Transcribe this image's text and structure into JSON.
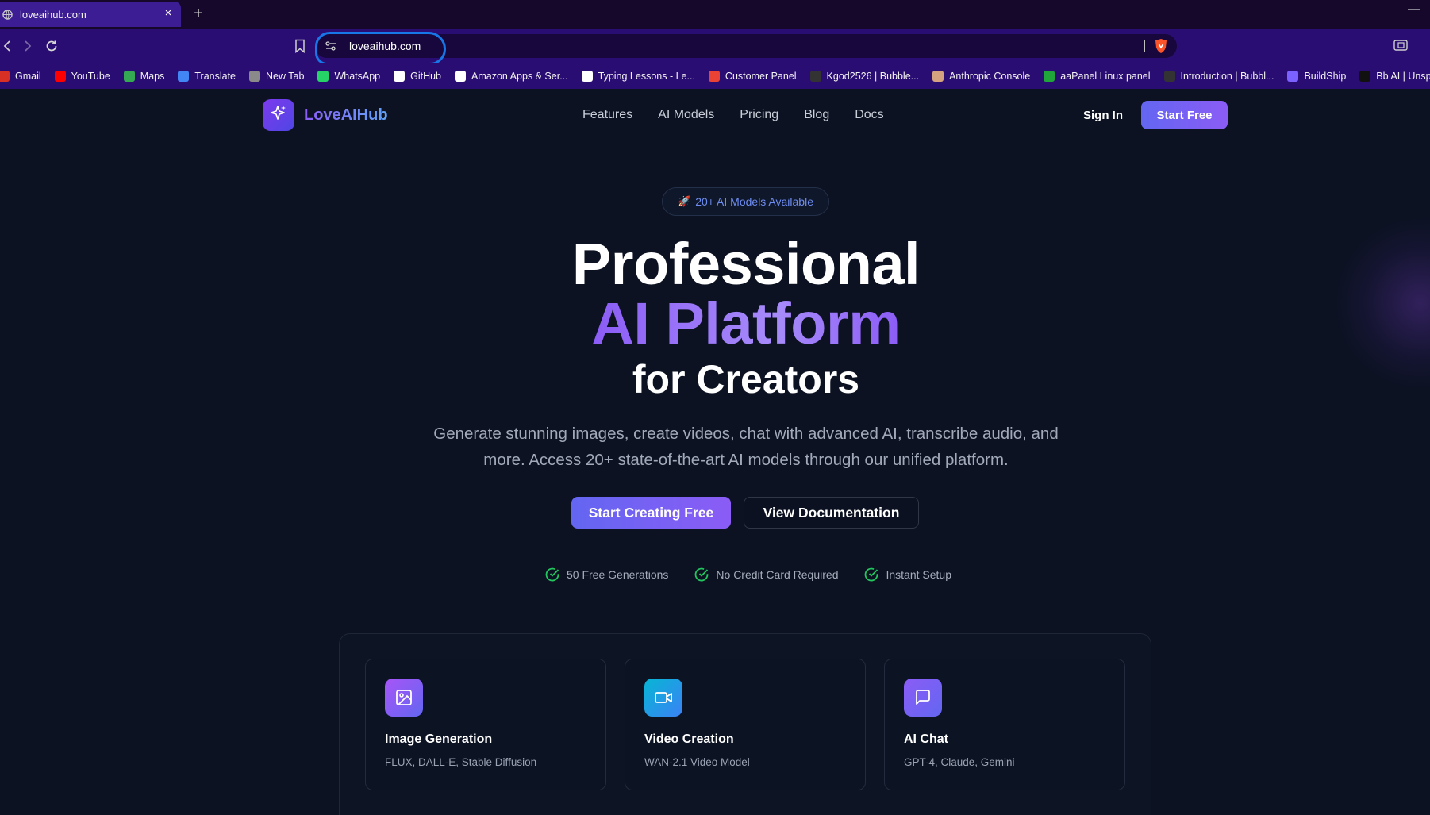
{
  "browser": {
    "tab_title": "loveaihub.com",
    "tab_close": "×",
    "new_tab": "+",
    "url": "loveaihub.com",
    "bookmarks": [
      {
        "label": "Gmail",
        "icon": "gmail-icon",
        "color": "#d93025"
      },
      {
        "label": "YouTube",
        "icon": "youtube-icon",
        "color": "#ff0000"
      },
      {
        "label": "Maps",
        "icon": "maps-icon",
        "color": "#34a853"
      },
      {
        "label": "Translate",
        "icon": "translate-icon",
        "color": "#4285f4"
      },
      {
        "label": "New Tab",
        "icon": "globe-icon",
        "color": "#8a8a8a"
      },
      {
        "label": "WhatsApp",
        "icon": "whatsapp-icon",
        "color": "#25d366"
      },
      {
        "label": "GitHub",
        "icon": "github-icon",
        "color": "#ffffff"
      },
      {
        "label": "Amazon Apps & Ser...",
        "icon": "amazon-icon",
        "color": "#ffffff"
      },
      {
        "label": "Typing Lessons - Le...",
        "icon": "typing-icon",
        "color": "#ffffff"
      },
      {
        "label": "Customer Panel",
        "icon": "google-icon",
        "color": "#ea4335"
      },
      {
        "label": "Kgod2526 | Bubble...",
        "icon": "bubble-icon",
        "color": "#333333"
      },
      {
        "label": "Anthropic Console",
        "icon": "anthropic-icon",
        "color": "#d4a27f"
      },
      {
        "label": "aaPanel Linux panel",
        "icon": "aapanel-icon",
        "color": "#20a53a"
      },
      {
        "label": "Introduction | Bubbl...",
        "icon": "bubble-icon",
        "color": "#333333"
      },
      {
        "label": "BuildShip",
        "icon": "buildship-icon",
        "color": "#7b61ff"
      },
      {
        "label": "Bb AI | Unsplash",
        "icon": "unsplash-icon",
        "color": "#111111"
      }
    ]
  },
  "site": {
    "brand": "LoveAIHub",
    "nav": [
      "Features",
      "AI Models",
      "Pricing",
      "Blog",
      "Docs"
    ],
    "sign_in": "Sign In",
    "start_free": "Start Free"
  },
  "hero": {
    "badge": "20+ AI Models Available",
    "badge_icon": "rocket-icon",
    "title_line1": "Professional",
    "title_line2": "AI Platform",
    "title_line3": "for Creators",
    "subtitle": "Generate stunning images, create videos, chat with advanced AI, transcribe audio, and more. Access 20+ state-of-the-art AI models through our unified platform.",
    "cta_primary": "Start Creating Free",
    "cta_secondary": "View Documentation",
    "features": [
      "50 Free Generations",
      "No Credit Card Required",
      "Instant Setup"
    ]
  },
  "cards": [
    {
      "title": "Image Generation",
      "desc": "FLUX, DALL-E, Stable Diffusion",
      "icon": "image-icon",
      "color_from": "#a855f7",
      "color_to": "#6366f1"
    },
    {
      "title": "Video Creation",
      "desc": "WAN-2.1 Video Model",
      "icon": "video-icon",
      "color_from": "#06b6d4",
      "color_to": "#3b82f6"
    },
    {
      "title": "AI Chat",
      "desc": "GPT-4, Claude, Gemini",
      "icon": "chat-icon",
      "color_from": "#8b5cf6",
      "color_to": "#6366f1"
    }
  ],
  "colors": {
    "background": "#0c1222",
    "accent": "#8b5cf6",
    "button_gradient_from": "#6366f1",
    "button_gradient_to": "#8b5cf6",
    "check_green": "#22c55e",
    "browser_toolbar": "#2a0d72"
  }
}
